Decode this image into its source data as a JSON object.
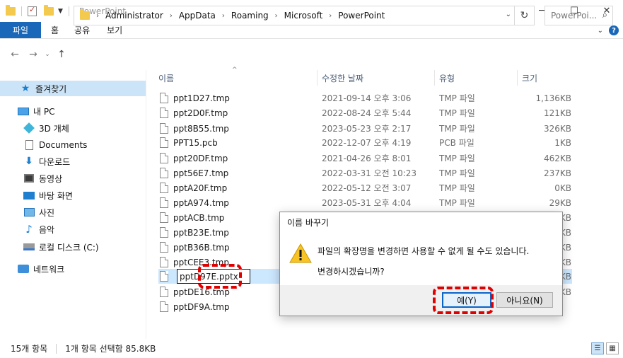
{
  "window": {
    "title": "PowerPoint",
    "controls": [
      "─",
      "☐",
      "✕"
    ]
  },
  "ribbon": {
    "tabs": [
      "파일",
      "홈",
      "공유",
      "보기"
    ]
  },
  "address": {
    "path": [
      "Administrator",
      "AppData",
      "Roaming",
      "Microsoft",
      "PowerPoint"
    ],
    "search_placeholder": "PowerPoi..."
  },
  "sidebar": {
    "items": [
      {
        "label": "즐겨찾기",
        "icon": "star-icon",
        "selected": true
      },
      {
        "label": "내 PC",
        "icon": "pc-icon"
      },
      {
        "label": "3D 개체",
        "icon": "3d-objects-icon"
      },
      {
        "label": "Documents",
        "icon": "document-icon"
      },
      {
        "label": "다운로드",
        "icon": "download-icon"
      },
      {
        "label": "동영상",
        "icon": "video-icon"
      },
      {
        "label": "바탕 화면",
        "icon": "desktop-icon"
      },
      {
        "label": "사진",
        "icon": "picture-icon"
      },
      {
        "label": "음악",
        "icon": "music-icon"
      },
      {
        "label": "로컬 디스크 (C:)",
        "icon": "drive-icon"
      },
      {
        "label": "네트워크",
        "icon": "network-icon"
      }
    ]
  },
  "columns": {
    "name": "이름",
    "date": "수정한 날짜",
    "type": "유형",
    "size": "크기"
  },
  "files": [
    {
      "name": "ppt1D27.tmp",
      "date": "2021-09-14 오후 3:06",
      "type": "TMP 파일",
      "size": "1,136KB"
    },
    {
      "name": "ppt2D0F.tmp",
      "date": "2022-08-24 오후 5:44",
      "type": "TMP 파일",
      "size": "121KB"
    },
    {
      "name": "ppt8B55.tmp",
      "date": "2023-05-23 오후 2:17",
      "type": "TMP 파일",
      "size": "326KB"
    },
    {
      "name": "PPT15.pcb",
      "date": "2022-12-07 오후 4:19",
      "type": "PCB 파일",
      "size": "1KB"
    },
    {
      "name": "ppt20DF.tmp",
      "date": "2021-04-26 오후 8:01",
      "type": "TMP 파일",
      "size": "462KB"
    },
    {
      "name": "ppt56E7.tmp",
      "date": "2022-03-31 오전 10:23",
      "type": "TMP 파일",
      "size": "237KB"
    },
    {
      "name": "pptA20F.tmp",
      "date": "2022-05-12 오전 3:07",
      "type": "TMP 파일",
      "size": "0KB"
    },
    {
      "name": "pptA974.tmp",
      "date": "2023-05-31 오후 4:04",
      "type": "TMP 파일",
      "size": "29KB"
    },
    {
      "name": "pptACB.tmp",
      "date": "",
      "type": "",
      "size": "KB"
    },
    {
      "name": "pptB23E.tmp",
      "date": "",
      "type": "",
      "size": "KB"
    },
    {
      "name": "pptB36B.tmp",
      "date": "",
      "type": "",
      "size": "KB"
    },
    {
      "name": "pptCEE3.tmp",
      "date": "",
      "type": "",
      "size": "KB"
    },
    {
      "name": "pptD97E.tmp",
      "date": "",
      "type": "",
      "size": "KB",
      "selected": true,
      "renaming": "pptD97E.pptx"
    },
    {
      "name": "pptDE16.tmp",
      "date": "",
      "type": "",
      "size": "KB"
    },
    {
      "name": "pptDF9A.tmp",
      "date": "",
      "type": "",
      "size": "KB"
    }
  ],
  "dialog": {
    "title": "이름 바꾸기",
    "message1": "파일의 확장명을 변경하면 사용할 수 없게 될 수도 있습니다.",
    "message2": "변경하시겠습니까?",
    "yes_label": "예(Y)",
    "no_label": "아니요(N)"
  },
  "status": {
    "count": "15개 항목",
    "selection": "1개 항목 선택함 85.8KB"
  },
  "colors": {
    "accent": "#1967b8",
    "selection": "#cce8ff",
    "highlight": "#e00000"
  }
}
